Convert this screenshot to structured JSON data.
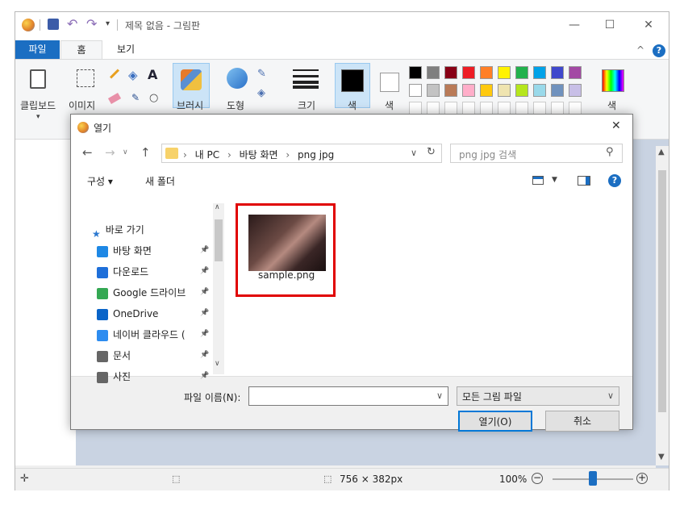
{
  "window": {
    "title": "제목 없음 - 그림판",
    "minimize": "—",
    "maximize": "☐",
    "close": "✕"
  },
  "menu": {
    "file": "파일",
    "home": "홈",
    "view": "보기",
    "collapse": "^",
    "help": "?"
  },
  "ribbon": {
    "clipboard": "클립보드",
    "image": "이미지",
    "brushes": "브러시",
    "shapes": "도형",
    "size": "크기",
    "color1": "색",
    "color2": "색",
    "edit_colors": "색"
  },
  "palette": {
    "row1": [
      "#000000",
      "#7f7f7f",
      "#880015",
      "#ed1c24",
      "#ff7f27",
      "#fff200",
      "#22b14c",
      "#00a2e8",
      "#3f48cc",
      "#a349a4"
    ],
    "row2": [
      "#ffffff",
      "#c3c3c3",
      "#b97a57",
      "#ffaec9",
      "#ffc90e",
      "#efe4b0",
      "#b5e61d",
      "#99d9ea",
      "#7092be",
      "#c8bfe7"
    ]
  },
  "dialog": {
    "title": "열기",
    "close": "✕",
    "path": [
      "내 PC",
      "바탕 화면",
      "png jpg"
    ],
    "search_placeholder": "png jpg 검색",
    "organize": "구성 ▾",
    "new_folder": "새 폴더",
    "nav": {
      "quick_access": "바로 가기",
      "items": [
        {
          "label": "바탕 화면",
          "icon": "desktop-icon",
          "color": "#1e88e5"
        },
        {
          "label": "다운로드",
          "icon": "download-icon",
          "color": "#1e6fd9"
        },
        {
          "label": "Google 드라이브",
          "icon": "google-drive-icon",
          "color": "#34a853"
        },
        {
          "label": "OneDrive",
          "icon": "onedrive-icon",
          "color": "#0a64c8"
        },
        {
          "label": "네이버 클라우드 (",
          "icon": "naver-cloud-icon",
          "color": "#2d8cf0"
        },
        {
          "label": "문서",
          "icon": "document-icon",
          "color": "#666666"
        },
        {
          "label": "사진",
          "icon": "picture-icon",
          "color": "#666666"
        }
      ]
    },
    "file": {
      "name": "sample.png"
    },
    "filename_label": "파일 이름(N):",
    "filename_value": "",
    "filter": "모든 그림 파일",
    "open_button": "열기(O)",
    "cancel_button": "취소"
  },
  "status": {
    "dimensions": "756 × 382px",
    "zoom": "100%",
    "zoom_level": 0.5
  }
}
